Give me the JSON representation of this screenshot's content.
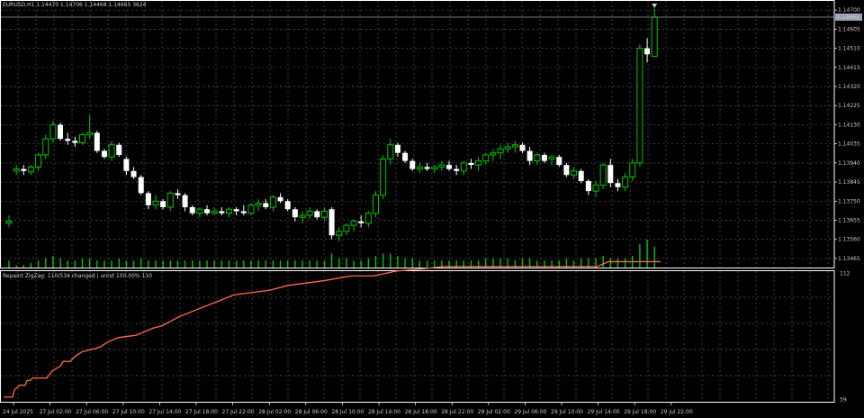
{
  "main_header": "EURUSD,H1  1.14470 1.14706 1.14468 1.14665 3624",
  "sub_header": "Repaint ZigZag: 110/534 changed | unrst 100.00% 110",
  "colors": {
    "background": "#000000",
    "grid": "#5a5a5a",
    "bull_candle": "#00c800",
    "bear_candle": "#ffffff",
    "volume": "#00c800",
    "indicator_line": "#ff6a4d",
    "price_marker": "#9aa0b4"
  },
  "price_axis": {
    "ticks": [
      "1.14700",
      "1.14605",
      "1.14510",
      "1.14415",
      "1.14320",
      "1.14225",
      "1.14130",
      "1.14035",
      "1.13940",
      "1.13845",
      "1.13750",
      "1.13655",
      "1.13560",
      "1.13465"
    ],
    "current_price": "1.14665",
    "range": [
      1.1342,
      1.1475
    ]
  },
  "indicator_axis": {
    "ticks": [
      "112",
      "59"
    ],
    "range": [
      58,
      113
    ]
  },
  "time_axis": {
    "labels": [
      "24 Jul 2025",
      "27 Jul 02:00",
      "27 Jul 06:00",
      "27 Jul 10:00",
      "27 Jul 14:00",
      "27 Jul 18:00",
      "27 Jul 22:00",
      "28 Jul 02:00",
      "28 Jul 06:00",
      "28 Jul 10:00",
      "28 Jul 14:00",
      "28 Jul 18:00",
      "28 Jul 22:00",
      "29 Jul 02:00",
      "29 Jul 06:00",
      "29 Jul 10:00",
      "29 Jul 14:00",
      "29 Jul 18:00",
      "29 Jul 22:00"
    ]
  },
  "chart_data": {
    "type": "candlestick",
    "symbol": "EURUSD",
    "timeframe": "H1",
    "candles": [
      [
        1.1364,
        1.1368,
        1.1362,
        1.1365
      ],
      [
        1.139,
        1.1393,
        1.1388,
        1.1391
      ],
      [
        1.1391,
        1.1393,
        1.1388,
        1.139
      ],
      [
        1.13895,
        1.1393,
        1.1388,
        1.1392
      ],
      [
        1.1392,
        1.1399,
        1.139,
        1.1398
      ],
      [
        1.1398,
        1.1408,
        1.1396,
        1.1406
      ],
      [
        1.1406,
        1.1415,
        1.1404,
        1.1413
      ],
      [
        1.1413,
        1.1414,
        1.1405,
        1.1406
      ],
      [
        1.1406,
        1.1409,
        1.1403,
        1.1405
      ],
      [
        1.1405,
        1.1407,
        1.1402,
        1.1404
      ],
      [
        1.1404,
        1.1409,
        1.1403,
        1.1408
      ],
      [
        1.1408,
        1.1418,
        1.1406,
        1.1409
      ],
      [
        1.1409,
        1.141,
        1.1399,
        1.14
      ],
      [
        1.14,
        1.1401,
        1.1396,
        1.1397
      ],
      [
        1.1397,
        1.1405,
        1.1395,
        1.1403
      ],
      [
        1.1403,
        1.1404,
        1.1397,
        1.1398
      ],
      [
        1.1396,
        1.1397,
        1.1388,
        1.139
      ],
      [
        1.139,
        1.1392,
        1.1386,
        1.1387
      ],
      [
        1.1387,
        1.1388,
        1.1378,
        1.1379
      ],
      [
        1.1379,
        1.138,
        1.1371,
        1.1373
      ],
      [
        1.1373,
        1.1378,
        1.1371,
        1.1375
      ],
      [
        1.1375,
        1.1376,
        1.1371,
        1.1372
      ],
      [
        1.1372,
        1.138,
        1.137,
        1.1379
      ],
      [
        1.1379,
        1.1381,
        1.1376,
        1.1378
      ],
      [
        1.1378,
        1.1379,
        1.137,
        1.1372
      ],
      [
        1.1372,
        1.1373,
        1.1368,
        1.1369
      ],
      [
        1.1369,
        1.1372,
        1.1367,
        1.1371
      ],
      [
        1.1371,
        1.1373,
        1.1368,
        1.1369
      ],
      [
        1.1369,
        1.1372,
        1.1368,
        1.137
      ],
      [
        1.137,
        1.1372,
        1.1368,
        1.1369
      ],
      [
        1.1369,
        1.1372,
        1.1367,
        1.1371
      ],
      [
        1.1371,
        1.1372,
        1.1368,
        1.137
      ],
      [
        1.137,
        1.1373,
        1.1368,
        1.1369
      ],
      [
        1.1369,
        1.1374,
        1.1368,
        1.1373
      ],
      [
        1.1373,
        1.1376,
        1.137,
        1.1374
      ],
      [
        1.1374,
        1.1376,
        1.1371,
        1.1372
      ],
      [
        1.1372,
        1.1378,
        1.137,
        1.1377
      ],
      [
        1.1377,
        1.1379,
        1.1374,
        1.1375
      ],
      [
        1.1375,
        1.1376,
        1.137,
        1.1371
      ],
      [
        1.1371,
        1.1372,
        1.1365,
        1.1367
      ],
      [
        1.1367,
        1.137,
        1.1364,
        1.1368
      ],
      [
        1.1368,
        1.1372,
        1.1366,
        1.137
      ],
      [
        1.137,
        1.1371,
        1.1366,
        1.1367
      ],
      [
        1.1367,
        1.1372,
        1.1365,
        1.137
      ],
      [
        1.1371,
        1.1372,
        1.1356,
        1.1358
      ],
      [
        1.1358,
        1.1362,
        1.1355,
        1.136
      ],
      [
        1.136,
        1.1364,
        1.1358,
        1.1363
      ],
      [
        1.1363,
        1.1366,
        1.136,
        1.1365
      ],
      [
        1.1365,
        1.1368,
        1.1362,
        1.1364
      ],
      [
        1.1364,
        1.137,
        1.1362,
        1.1369
      ],
      [
        1.1369,
        1.138,
        1.1367,
        1.1378
      ],
      [
        1.1378,
        1.1398,
        1.1376,
        1.1396
      ],
      [
        1.1396,
        1.1406,
        1.1393,
        1.1403
      ],
      [
        1.1403,
        1.1404,
        1.1397,
        1.1399
      ],
      [
        1.1399,
        1.14,
        1.1394,
        1.1395
      ],
      [
        1.1395,
        1.1396,
        1.139,
        1.1391
      ],
      [
        1.1391,
        1.1394,
        1.1389,
        1.1392
      ],
      [
        1.1392,
        1.1394,
        1.139,
        1.1391
      ],
      [
        1.1391,
        1.1393,
        1.1389,
        1.1392
      ],
      [
        1.1392,
        1.1395,
        1.139,
        1.1393
      ],
      [
        1.1393,
        1.1395,
        1.139,
        1.1391
      ],
      [
        1.1391,
        1.1393,
        1.1388,
        1.139
      ],
      [
        1.139,
        1.1395,
        1.1388,
        1.1394
      ],
      [
        1.1394,
        1.1396,
        1.1391,
        1.1393
      ],
      [
        1.1393,
        1.1397,
        1.139,
        1.1395
      ],
      [
        1.1395,
        1.1399,
        1.1393,
        1.1398
      ],
      [
        1.1398,
        1.1401,
        1.1395,
        1.1399
      ],
      [
        1.1399,
        1.1403,
        1.1396,
        1.1401
      ],
      [
        1.1401,
        1.1404,
        1.1399,
        1.1402
      ],
      [
        1.1402,
        1.1405,
        1.1399,
        1.1403
      ],
      [
        1.1403,
        1.1404,
        1.1399,
        1.14
      ],
      [
        1.14,
        1.1402,
        1.1393,
        1.1395
      ],
      [
        1.1395,
        1.1399,
        1.1393,
        1.1398
      ],
      [
        1.1398,
        1.1399,
        1.1394,
        1.1395
      ],
      [
        1.1396,
        1.1398,
        1.1393,
        1.1397
      ],
      [
        1.1397,
        1.1398,
        1.1392,
        1.1393
      ],
      [
        1.1393,
        1.1394,
        1.1387,
        1.1388
      ],
      [
        1.1388,
        1.1392,
        1.1386,
        1.139
      ],
      [
        1.139,
        1.1391,
        1.1384,
        1.1385
      ],
      [
        1.1385,
        1.1386,
        1.1378,
        1.138
      ],
      [
        1.138,
        1.1385,
        1.1377,
        1.1383
      ],
      [
        1.1383,
        1.1394,
        1.1381,
        1.1393
      ],
      [
        1.1393,
        1.1396,
        1.1382,
        1.1384
      ],
      [
        1.1384,
        1.1386,
        1.138,
        1.1382
      ],
      [
        1.1382,
        1.1389,
        1.138,
        1.1387
      ],
      [
        1.1387,
        1.1396,
        1.1385,
        1.1394
      ],
      [
        1.1394,
        1.1453,
        1.1392,
        1.1451
      ],
      [
        1.1451,
        1.1456,
        1.1444,
        1.1448
      ],
      [
        1.1447,
        1.14706,
        1.14468,
        1.14665
      ]
    ],
    "volumes": [
      3,
      1,
      1,
      2,
      3,
      4,
      5,
      4,
      3,
      3,
      4,
      4,
      3,
      3,
      3,
      4,
      3,
      3,
      4,
      3,
      3,
      3,
      3,
      3,
      3,
      3,
      3,
      3,
      3,
      3,
      3,
      3,
      3,
      3,
      3,
      3,
      3,
      3,
      3,
      3,
      3,
      3,
      3,
      3,
      6,
      4,
      4,
      3,
      3,
      4,
      5,
      6,
      6,
      5,
      4,
      4,
      3,
      3,
      3,
      3,
      3,
      3,
      3,
      3,
      3,
      4,
      4,
      4,
      4,
      3,
      4,
      4,
      3,
      3,
      3,
      3,
      4,
      3,
      4,
      4,
      4,
      5,
      4,
      4,
      4,
      5,
      10,
      12,
      9
    ],
    "indicator": {
      "name": "Repaint ZigZag",
      "points": [
        [
          0,
          60
        ],
        [
          10,
          60
        ],
        [
          12,
          63
        ],
        [
          18,
          65
        ],
        [
          24,
          65
        ],
        [
          26,
          67
        ],
        [
          30,
          67
        ],
        [
          32,
          68
        ],
        [
          48,
          68
        ],
        [
          54,
          71
        ],
        [
          63,
          73
        ],
        [
          66,
          75
        ],
        [
          74,
          75
        ],
        [
          79,
          77
        ],
        [
          87,
          79
        ],
        [
          97,
          80
        ],
        [
          107,
          81
        ],
        [
          115,
          83
        ],
        [
          127,
          85
        ],
        [
          147,
          86
        ],
        [
          166,
          89
        ],
        [
          176,
          90
        ],
        [
          196,
          94
        ],
        [
          216,
          97
        ],
        [
          236,
          100
        ],
        [
          256,
          103
        ],
        [
          296,
          105
        ],
        [
          316,
          107
        ],
        [
          356,
          109
        ],
        [
          386,
          111
        ],
        [
          411,
          111
        ],
        [
          436,
          113
        ],
        [
          466,
          114
        ],
        [
          490,
          115
        ],
        [
          520,
          115
        ],
        [
          660,
          115
        ],
        [
          672,
          117
        ],
        [
          730,
          117
        ]
      ],
      "points_units": "[bar-like x (0..730), value]"
    }
  }
}
